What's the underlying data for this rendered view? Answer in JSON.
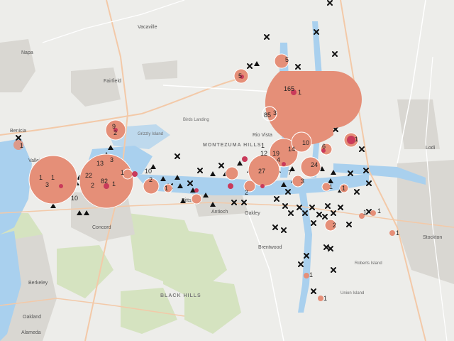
{
  "map": {
    "colors": {
      "land": "#ededea",
      "water": "#a9d0ee",
      "park": "#cfe0b6",
      "urban": "#d9d7d2",
      "road_major": "#f3c9a8",
      "road_minor": "#ffffff",
      "cluster_fill": "#e58f78",
      "cluster_dot": "#c93a5a",
      "marker": "#111111"
    },
    "place_labels": {
      "napa": "Napa",
      "fairfield": "Fairfield",
      "vacaville": "Vacaville",
      "benicia": "Benicia",
      "vallejo": "Vallejo",
      "concord": "Concord",
      "pittsburg": "Pittsburg",
      "antioch": "Antioch",
      "oakley": "Oakley",
      "brentwood": "Brentwood",
      "berkeley": "Berkeley",
      "oakland": "Oakland",
      "alameda": "Alameda",
      "stockton": "Stockton",
      "lodi": "Lodi",
      "rio_vista": "Rio Vista",
      "grizzly_island": "Grizzly Island",
      "montezuma_hills": "MONTEZUMA HILLS",
      "black_hills": "BLACK HILLS",
      "roberts_island": "Roberts Island",
      "union_island": "Union Island",
      "birds_landing": "Birds Landing"
    },
    "clusters": [
      {
        "count": "1",
        "label_pos": "a"
      },
      {
        "count": "10"
      },
      {
        "count": "1"
      },
      {
        "count": "3"
      },
      {
        "count": "1"
      },
      {
        "count": "13"
      },
      {
        "count": "22"
      },
      {
        "count": "3"
      },
      {
        "count": "82"
      },
      {
        "count": "1"
      },
      {
        "count": "2"
      },
      {
        "count": "9"
      },
      {
        "count": "2"
      },
      {
        "count": "10"
      },
      {
        "count": "1"
      },
      {
        "count": "2"
      },
      {
        "count": "1"
      },
      {
        "count": "5"
      },
      {
        "count": "5"
      },
      {
        "count": "165"
      },
      {
        "count": "1"
      },
      {
        "count": "85"
      },
      {
        "count": "3"
      },
      {
        "count": "1"
      },
      {
        "count": "12"
      },
      {
        "count": "19"
      },
      {
        "count": "14"
      },
      {
        "count": "10"
      },
      {
        "count": "4"
      },
      {
        "count": "27"
      },
      {
        "count": "24"
      },
      {
        "count": "6"
      },
      {
        "count": "7"
      },
      {
        "count": "2"
      },
      {
        "count": "3"
      },
      {
        "count": "1"
      },
      {
        "count": "2"
      },
      {
        "count": "1"
      },
      {
        "count": "1"
      },
      {
        "count": "1"
      },
      {
        "count": "1"
      },
      {
        "count": "1"
      },
      {
        "count": "1"
      },
      {
        "count": "1"
      }
    ]
  }
}
